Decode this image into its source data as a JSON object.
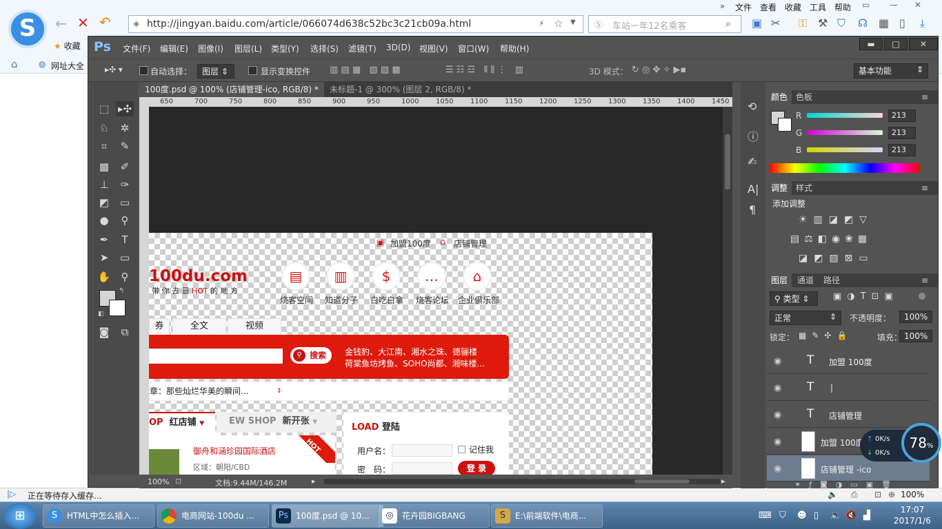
{
  "browser": {
    "url": "http://jingyan.baidu.com/article/066074d638c52bc3c21cb09a.html",
    "search_placeholder": "车站一年12名乘客",
    "menu": [
      "文件",
      "查看",
      "收藏",
      "工具",
      "帮助"
    ],
    "favorites_label": "收藏",
    "nav_label": "网址大全",
    "status": "正在等待存入缓存..."
  },
  "ps": {
    "logo": "Ps",
    "menu": [
      "文件(F)",
      "编辑(E)",
      "图像(I)",
      "图层(L)",
      "类型(Y)",
      "选择(S)",
      "滤镜(T)",
      "3D(D)",
      "视图(V)",
      "窗口(W)",
      "帮助(H)"
    ],
    "options": {
      "auto_select_label": "自动选择：",
      "auto_select_value": "图层",
      "transform_label": "显示变换控件",
      "mode3d_label": "3D 模式：",
      "workspace": "基本功能"
    },
    "tabs": [
      "100度.psd @ 100% (店铺管理-ico, RGB/8) *",
      "未标题-1 @ 300% (图层 2, RGB/8) *"
    ],
    "ruler": [
      "650",
      "700",
      "750",
      "800",
      "850",
      "900",
      "950",
      "1000",
      "1050",
      "1100",
      "1150",
      "1200",
      "1250",
      "1300",
      "1350",
      "1400",
      "1450"
    ],
    "status": {
      "zoom": "100%",
      "doc": "文档:9.44M/146.2M"
    }
  },
  "artwork": {
    "top_links": [
      "加盟100度",
      "店铺管理"
    ],
    "logo": "100du.com",
    "slogan_prefix": "带 你 去 最 ",
    "slogan_hot": "HOT",
    "slogan_suffix": " 的 地 方",
    "categories": [
      {
        "label": "烧客空间",
        "icon": "briefcase-icon"
      },
      {
        "label": "知道分子",
        "icon": "book-icon"
      },
      {
        "label": "白吃白拿",
        "icon": "money-bag-icon"
      },
      {
        "label": "烧客论坛",
        "icon": "chat-icon"
      },
      {
        "label": "企业俱乐部",
        "icon": "building-icon"
      }
    ],
    "tabs": [
      "券",
      "全文",
      "视频"
    ],
    "search_button": "搜索",
    "hot_line1": "金钱豹、大江南、湘水之珠、德骊楼",
    "hot_line2": "荷棠鱼坊烤鱼、SOHO尚都、湘味楼...",
    "news": "章：那些灿烂华美的瞬间...",
    "shop_tab1_prefix": "OP",
    "shop_tab1": "红店铺",
    "shop_tab2_prefix": "EW SHOP",
    "shop_tab2": "新开张",
    "login_prefix": "LOAD",
    "login_title": "登陆",
    "hotel": "御舟和涵珍园国际酒店",
    "area": "区域：朝阳/CBD",
    "hot_badge": "HOT",
    "username_label": "用户名：",
    "password_label": "密　码：",
    "remember": "记住我",
    "login_btn": "登 录"
  },
  "panels": {
    "color_tabs": [
      "颜色",
      "色板"
    ],
    "rgb": [
      {
        "label": "R",
        "value": "213"
      },
      {
        "label": "G",
        "value": "213"
      },
      {
        "label": "B",
        "value": "213"
      }
    ],
    "adjust_tabs": [
      "调整",
      "样式"
    ],
    "add_adjust": "添加调整",
    "layer_tabs": [
      "图层",
      "通道",
      "路径"
    ],
    "kind": "类型",
    "blend": "正常",
    "opacity_label": "不透明度：",
    "opacity": "100%",
    "lock_label": "锁定：",
    "fill_label": "填充：",
    "fill": "100%",
    "layers": [
      {
        "name": "加盟 100度",
        "type": "text"
      },
      {
        "name": "|",
        "type": "text"
      },
      {
        "name": "店铺管理",
        "type": "text"
      },
      {
        "name": "加盟 100度 -ico",
        "type": "image"
      },
      {
        "name": "店铺管理 -ico",
        "type": "image"
      }
    ]
  },
  "network": {
    "up": "0K/s",
    "down": "0K/s",
    "percent": "78",
    "unit": "%"
  },
  "bottom_zoom": "100%",
  "taskbar": {
    "items": [
      {
        "label": "HTML中怎么插入...",
        "icon_color": "#3a8fe0"
      },
      {
        "label": "电商网站-100du ...",
        "icon_color": "#e0a020"
      },
      {
        "label": "100度.psd @ 10...",
        "icon_color": "#0c2a4a"
      },
      {
        "label": "花卉园BIGBANG",
        "icon_color": "#ffffff"
      },
      {
        "label": "E:\\前端软件\\电商...",
        "icon_color": "#d2a84a"
      }
    ],
    "time": "17:07",
    "date": "2017/1/6"
  }
}
